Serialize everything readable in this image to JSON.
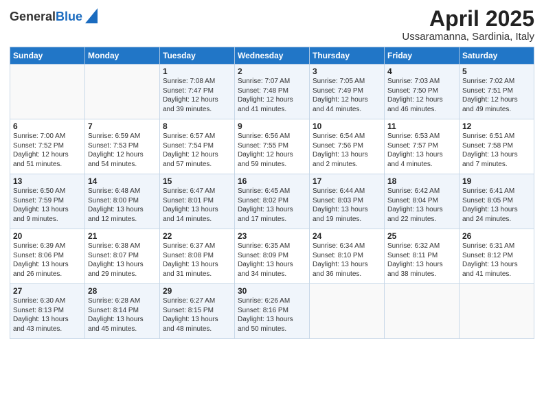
{
  "logo": {
    "general": "General",
    "blue": "Blue"
  },
  "header": {
    "month": "April 2025",
    "location": "Ussaramanna, Sardinia, Italy"
  },
  "weekdays": [
    "Sunday",
    "Monday",
    "Tuesday",
    "Wednesday",
    "Thursday",
    "Friday",
    "Saturday"
  ],
  "weeks": [
    [
      {
        "day": "",
        "info": ""
      },
      {
        "day": "",
        "info": ""
      },
      {
        "day": "1",
        "info": "Sunrise: 7:08 AM\nSunset: 7:47 PM\nDaylight: 12 hours\nand 39 minutes."
      },
      {
        "day": "2",
        "info": "Sunrise: 7:07 AM\nSunset: 7:48 PM\nDaylight: 12 hours\nand 41 minutes."
      },
      {
        "day": "3",
        "info": "Sunrise: 7:05 AM\nSunset: 7:49 PM\nDaylight: 12 hours\nand 44 minutes."
      },
      {
        "day": "4",
        "info": "Sunrise: 7:03 AM\nSunset: 7:50 PM\nDaylight: 12 hours\nand 46 minutes."
      },
      {
        "day": "5",
        "info": "Sunrise: 7:02 AM\nSunset: 7:51 PM\nDaylight: 12 hours\nand 49 minutes."
      }
    ],
    [
      {
        "day": "6",
        "info": "Sunrise: 7:00 AM\nSunset: 7:52 PM\nDaylight: 12 hours\nand 51 minutes."
      },
      {
        "day": "7",
        "info": "Sunrise: 6:59 AM\nSunset: 7:53 PM\nDaylight: 12 hours\nand 54 minutes."
      },
      {
        "day": "8",
        "info": "Sunrise: 6:57 AM\nSunset: 7:54 PM\nDaylight: 12 hours\nand 57 minutes."
      },
      {
        "day": "9",
        "info": "Sunrise: 6:56 AM\nSunset: 7:55 PM\nDaylight: 12 hours\nand 59 minutes."
      },
      {
        "day": "10",
        "info": "Sunrise: 6:54 AM\nSunset: 7:56 PM\nDaylight: 13 hours\nand 2 minutes."
      },
      {
        "day": "11",
        "info": "Sunrise: 6:53 AM\nSunset: 7:57 PM\nDaylight: 13 hours\nand 4 minutes."
      },
      {
        "day": "12",
        "info": "Sunrise: 6:51 AM\nSunset: 7:58 PM\nDaylight: 13 hours\nand 7 minutes."
      }
    ],
    [
      {
        "day": "13",
        "info": "Sunrise: 6:50 AM\nSunset: 7:59 PM\nDaylight: 13 hours\nand 9 minutes."
      },
      {
        "day": "14",
        "info": "Sunrise: 6:48 AM\nSunset: 8:00 PM\nDaylight: 13 hours\nand 12 minutes."
      },
      {
        "day": "15",
        "info": "Sunrise: 6:47 AM\nSunset: 8:01 PM\nDaylight: 13 hours\nand 14 minutes."
      },
      {
        "day": "16",
        "info": "Sunrise: 6:45 AM\nSunset: 8:02 PM\nDaylight: 13 hours\nand 17 minutes."
      },
      {
        "day": "17",
        "info": "Sunrise: 6:44 AM\nSunset: 8:03 PM\nDaylight: 13 hours\nand 19 minutes."
      },
      {
        "day": "18",
        "info": "Sunrise: 6:42 AM\nSunset: 8:04 PM\nDaylight: 13 hours\nand 22 minutes."
      },
      {
        "day": "19",
        "info": "Sunrise: 6:41 AM\nSunset: 8:05 PM\nDaylight: 13 hours\nand 24 minutes."
      }
    ],
    [
      {
        "day": "20",
        "info": "Sunrise: 6:39 AM\nSunset: 8:06 PM\nDaylight: 13 hours\nand 26 minutes."
      },
      {
        "day": "21",
        "info": "Sunrise: 6:38 AM\nSunset: 8:07 PM\nDaylight: 13 hours\nand 29 minutes."
      },
      {
        "day": "22",
        "info": "Sunrise: 6:37 AM\nSunset: 8:08 PM\nDaylight: 13 hours\nand 31 minutes."
      },
      {
        "day": "23",
        "info": "Sunrise: 6:35 AM\nSunset: 8:09 PM\nDaylight: 13 hours\nand 34 minutes."
      },
      {
        "day": "24",
        "info": "Sunrise: 6:34 AM\nSunset: 8:10 PM\nDaylight: 13 hours\nand 36 minutes."
      },
      {
        "day": "25",
        "info": "Sunrise: 6:32 AM\nSunset: 8:11 PM\nDaylight: 13 hours\nand 38 minutes."
      },
      {
        "day": "26",
        "info": "Sunrise: 6:31 AM\nSunset: 8:12 PM\nDaylight: 13 hours\nand 41 minutes."
      }
    ],
    [
      {
        "day": "27",
        "info": "Sunrise: 6:30 AM\nSunset: 8:13 PM\nDaylight: 13 hours\nand 43 minutes."
      },
      {
        "day": "28",
        "info": "Sunrise: 6:28 AM\nSunset: 8:14 PM\nDaylight: 13 hours\nand 45 minutes."
      },
      {
        "day": "29",
        "info": "Sunrise: 6:27 AM\nSunset: 8:15 PM\nDaylight: 13 hours\nand 48 minutes."
      },
      {
        "day": "30",
        "info": "Sunrise: 6:26 AM\nSunset: 8:16 PM\nDaylight: 13 hours\nand 50 minutes."
      },
      {
        "day": "",
        "info": ""
      },
      {
        "day": "",
        "info": ""
      },
      {
        "day": "",
        "info": ""
      }
    ]
  ]
}
